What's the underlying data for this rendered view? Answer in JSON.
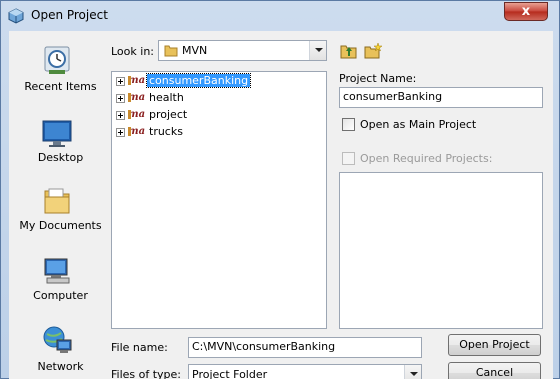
{
  "window": {
    "title": "Open Project",
    "close_label": "x"
  },
  "places": [
    {
      "label": "Recent Items",
      "icon": "recent-items-icon"
    },
    {
      "label": "Desktop",
      "icon": "desktop-icon"
    },
    {
      "label": "My Documents",
      "icon": "my-documents-icon"
    },
    {
      "label": "Computer",
      "icon": "computer-icon"
    },
    {
      "label": "Network",
      "icon": "network-icon"
    }
  ],
  "look_in": {
    "label": "Look in:",
    "value": "MVN"
  },
  "tree": {
    "items": [
      {
        "label": "consumerBanking",
        "selected": true
      },
      {
        "label": "health",
        "selected": false
      },
      {
        "label": "project",
        "selected": false
      },
      {
        "label": "trucks",
        "selected": false
      }
    ],
    "icon_text": "ma"
  },
  "project_panel": {
    "name_label": "Project Name:",
    "name_value": "consumerBanking",
    "main_project_label": "Open as Main Project",
    "required_label": "Open Required Projects:"
  },
  "file_name": {
    "label": "File name:",
    "value": "C:\\MVN\\consumerBanking"
  },
  "files_of_type": {
    "label": "Files of type:",
    "value": "Project Folder"
  },
  "buttons": {
    "open": "Open Project",
    "cancel": "Cancel"
  },
  "colors": {
    "selection": "#3399ff",
    "close_button": "#c7453a",
    "frame": "#bcd0e8"
  }
}
